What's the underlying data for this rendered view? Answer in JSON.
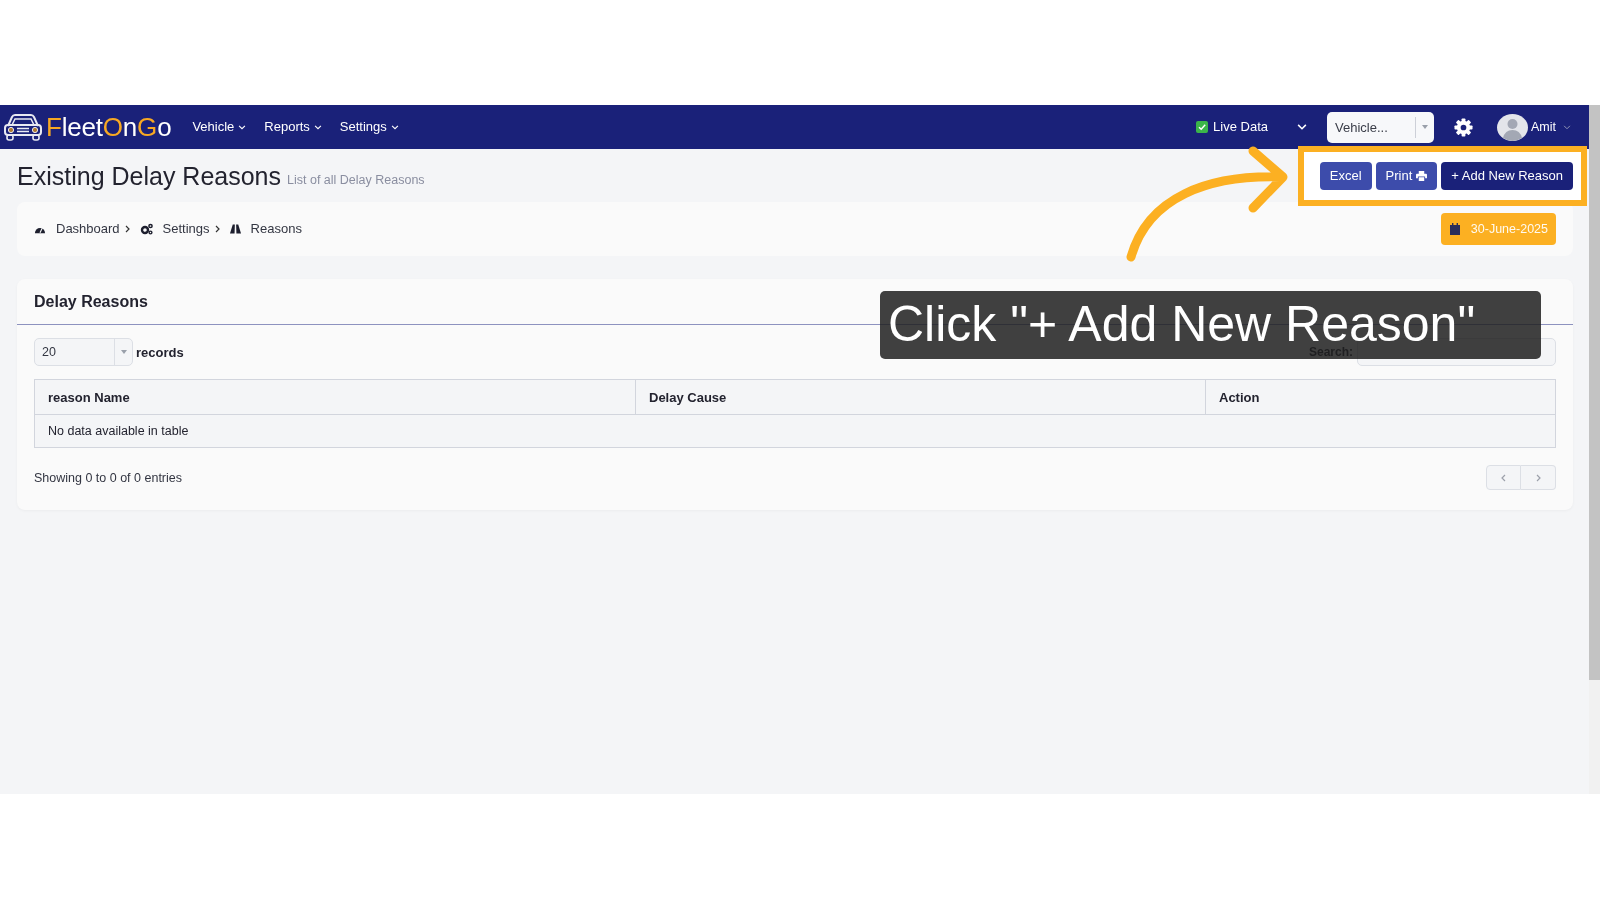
{
  "navbar": {
    "logo": [
      {
        "text": "F",
        "color": "#f7a823"
      },
      {
        "text": "leet",
        "color": "#ffffff"
      },
      {
        "text": "O",
        "color": "#f7a823"
      },
      {
        "text": "n",
        "color": "#ffffff"
      },
      {
        "text": "G",
        "color": "#f7a823"
      },
      {
        "text": "o",
        "color": "#ffffff"
      }
    ],
    "menu": [
      {
        "label": "Vehicle"
      },
      {
        "label": "Reports"
      },
      {
        "label": "Settings"
      }
    ],
    "live_data": {
      "label": "Live Data",
      "checked": true
    },
    "vehicle_select": {
      "value": "Vehicle..."
    },
    "user": {
      "name": "Amit"
    }
  },
  "page_header": {
    "title": "Existing Delay Reasons",
    "subtitle": "List of all Delay Reasons",
    "buttons": [
      {
        "label": "Excel",
        "kind": "export"
      },
      {
        "label": "Print",
        "kind": "print"
      },
      {
        "label": "+ Add New Reason",
        "kind": "primary"
      }
    ]
  },
  "breadcrumb": {
    "items": [
      {
        "label": "Dashboard",
        "kind": "dashboard"
      },
      {
        "label": "Settings",
        "kind": "settings"
      },
      {
        "label": "Reasons",
        "kind": "road"
      }
    ],
    "date": "30-June-2025"
  },
  "card": {
    "title": "Delay Reasons",
    "page_length": {
      "value": "20",
      "label": "records"
    },
    "search": {
      "label": "Search:"
    },
    "table": {
      "columns": [
        "reason Name",
        "Delay Cause",
        "Action"
      ],
      "empty_message": "No data available in table"
    },
    "info": "Showing 0 to 0 of 0 entries",
    "pagination": [
      {
        "kind": "previous",
        "disabled": true
      },
      {
        "kind": "next",
        "disabled": true
      }
    ]
  },
  "annotation": {
    "callout": "Click \"+ Add New Reason\""
  }
}
